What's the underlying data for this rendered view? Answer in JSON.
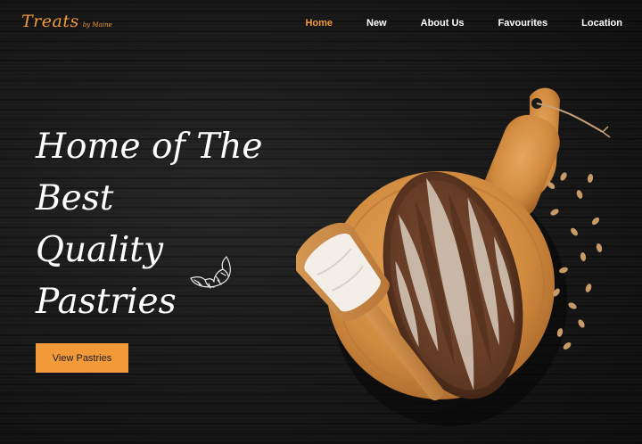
{
  "brand": {
    "name": "Treats",
    "tagline": "by Maine"
  },
  "nav": {
    "items": [
      {
        "label": "Home",
        "active": true
      },
      {
        "label": "New",
        "active": false
      },
      {
        "label": "About Us",
        "active": false
      },
      {
        "label": "Favourites",
        "active": false
      },
      {
        "label": "Location",
        "active": false
      }
    ]
  },
  "hero": {
    "title_lines": [
      "Home of The",
      "Best",
      "Quality",
      "Pastries"
    ],
    "cta_label": "View Pastries"
  },
  "colors": {
    "accent": "#f29a3a",
    "background": "#141414",
    "text": "#ffffff"
  },
  "icons": {
    "decoration": "croissant-sketch-icon",
    "image": "bread-on-cutting-board"
  }
}
